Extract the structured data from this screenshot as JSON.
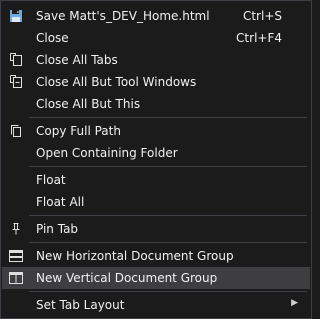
{
  "menu": {
    "items": [
      {
        "label": "Save Matt's_DEV_Home.html",
        "shortcut": "Ctrl+S",
        "icon": "save-icon"
      },
      {
        "label": "Close",
        "shortcut": "Ctrl+F4"
      },
      {
        "label": "Close All Tabs",
        "icon": "close-all-tabs-icon"
      },
      {
        "label": "Close All But Tool Windows",
        "icon": "close-all-but-tool-windows-icon"
      },
      {
        "label": "Close All But This"
      },
      {
        "label": "Copy Full Path",
        "icon": "copy-icon"
      },
      {
        "label": "Open Containing Folder"
      },
      {
        "label": "Float"
      },
      {
        "label": "Float All"
      },
      {
        "label": "Pin Tab",
        "icon": "pin-icon"
      },
      {
        "label": "New Horizontal Document Group",
        "icon": "horizontal-group-icon"
      },
      {
        "label": "New Vertical Document Group",
        "icon": "vertical-group-icon",
        "highlighted": true
      },
      {
        "label": "Set Tab Layout",
        "submenu": true,
        "icon": "chevron-right-icon"
      }
    ]
  },
  "colors": {
    "background": "#1b1b1c",
    "highlight": "#3e3e40",
    "text": "#f1f1f1",
    "separator": "#3f3f46",
    "save_icon": "#6fa8dc"
  }
}
